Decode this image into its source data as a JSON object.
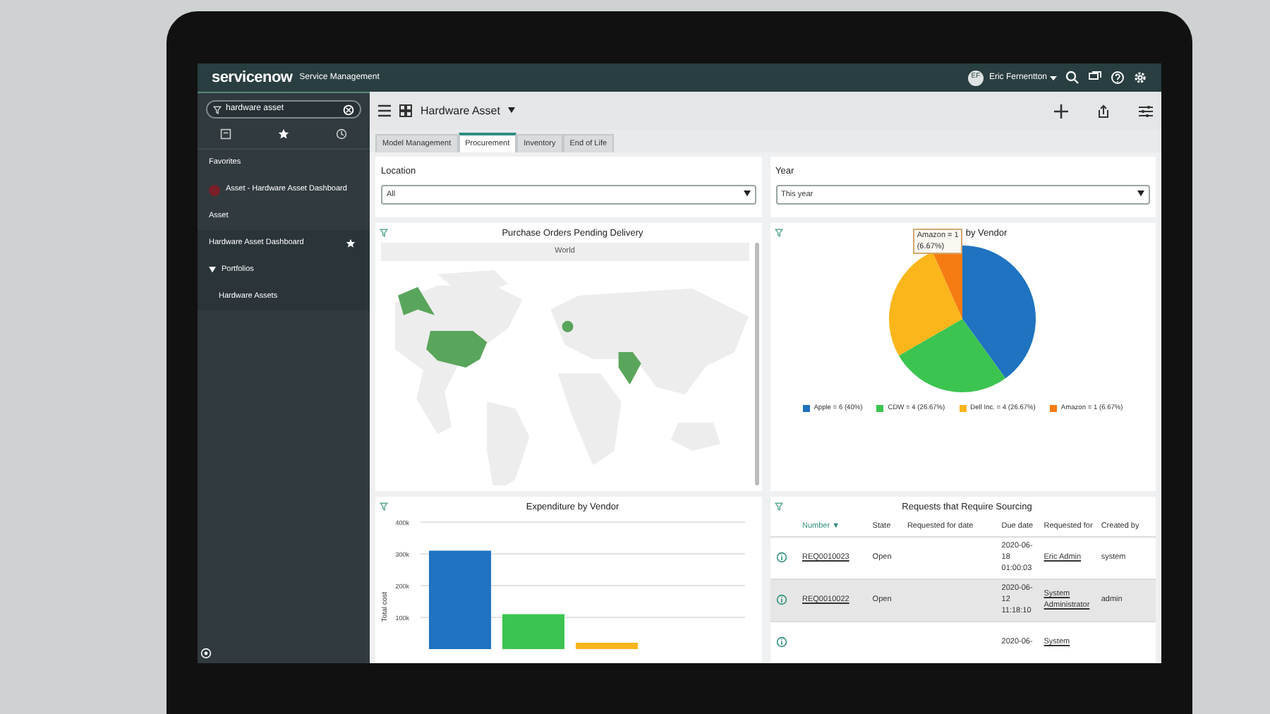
{
  "header": {
    "logo": "servicenow",
    "product": "Service Management",
    "user": {
      "initials": "EF",
      "name": "Eric Fernentton"
    }
  },
  "sidebar": {
    "search": {
      "value": "hardware asset"
    },
    "sections": [
      {
        "title": "Favorites",
        "items": [
          {
            "label": "Asset - Hardware Asset Dashboard",
            "kind": "favorite"
          }
        ]
      },
      {
        "title": "Asset",
        "items": [
          {
            "label": "Hardware Asset Dashboard",
            "kind": "starred"
          },
          {
            "label": "Portfolios",
            "kind": "folder",
            "expanded": true,
            "children": [
              {
                "label": "Hardware Assets",
                "kind": "link"
              }
            ]
          }
        ]
      }
    ]
  },
  "toolbar": {
    "title": "Hardware Asset"
  },
  "tabs": [
    {
      "label": "Model Management",
      "selected": false
    },
    {
      "label": "Procurement",
      "selected": true
    },
    {
      "label": "Inventory",
      "selected": false
    },
    {
      "label": "End of Life",
      "selected": false
    }
  ],
  "filters": [
    {
      "label": "Location",
      "value": "All"
    },
    {
      "label": "Year",
      "value": "This year"
    }
  ],
  "map_panel": {
    "title": "Purchase Orders Pending Delivery",
    "region": "World"
  },
  "pie_panel": {
    "title": "by Vendor",
    "tooltip": [
      "Amazon = 1",
      "(6.67%)"
    ],
    "chart_data": {
      "type": "pie",
      "categories": [
        "Apple = 6 (40%)",
        "CDW = 4 (26.67%)",
        "Dell Inc. = 4 (26.67%)",
        "Amazon = 1 (6.67%)"
      ],
      "values": [
        6,
        4,
        4,
        1
      ],
      "colors": [
        "#1f73c0",
        "#3cc450",
        "#fbb61b",
        "#f57c13"
      ],
      "legend": "bottom"
    }
  },
  "bar_panel": {
    "title": "Expenditure by Vendor",
    "chart_data": {
      "type": "bar",
      "ylabel": "Total cost",
      "ylim": [
        0,
        400000
      ],
      "grid": true,
      "yticks": [
        {
          "value": 100000,
          "label": "100k"
        },
        {
          "value": 200000,
          "label": "200k"
        },
        {
          "value": 300000,
          "label": "300k"
        },
        {
          "value": 400000,
          "label": "400k"
        }
      ],
      "values": [
        310000,
        110000,
        20000
      ],
      "colors": [
        "#1f73c0",
        "#3cc450",
        "#fbb61b"
      ]
    }
  },
  "table_panel": {
    "title": "Requests that Require Sourcing",
    "columns": [
      "Number ▼",
      "State",
      "Requested for date",
      "Due date",
      "Requested for",
      "Created by"
    ],
    "rows": [
      {
        "number": "REQ0010023",
        "state": "Open",
        "requested_for_date": "",
        "due_date": "2020-06-18 01:00:03",
        "requested_for": "Eric Admin",
        "created_by": "system"
      },
      {
        "number": "REQ0010022",
        "state": "Open",
        "requested_for_date": "",
        "due_date": "2020-06-12 11:18:10",
        "requested_for": "System Administrator",
        "created_by": "admin"
      },
      {
        "number": "",
        "state": "",
        "requested_for_date": "",
        "due_date": "2020-06-",
        "requested_for": "System",
        "created_by": ""
      }
    ]
  }
}
